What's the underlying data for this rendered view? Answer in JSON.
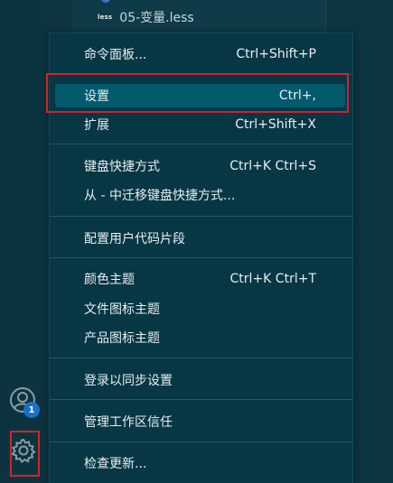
{
  "explorer": {
    "file_name": "05-变量.less",
    "file_badge": "less"
  },
  "activity_bar": {
    "accounts_badge": "1"
  },
  "menu": {
    "items": [
      {
        "label": "命令面板...",
        "shortcut": "Ctrl+Shift+P"
      },
      {
        "label": "设置",
        "shortcut": "Ctrl+,"
      },
      {
        "label": "扩展",
        "shortcut": "Ctrl+Shift+X"
      },
      {
        "label": "键盘快捷方式",
        "shortcut": "Ctrl+K Ctrl+S"
      },
      {
        "label": "从 - 中迁移键盘快捷方式...",
        "shortcut": ""
      },
      {
        "label": "配置用户代码片段",
        "shortcut": ""
      },
      {
        "label": "颜色主题",
        "shortcut": "Ctrl+K Ctrl+T"
      },
      {
        "label": "文件图标主题",
        "shortcut": ""
      },
      {
        "label": "产品图标主题",
        "shortcut": ""
      },
      {
        "label": "登录以同步设置",
        "shortcut": ""
      },
      {
        "label": "管理工作区信任",
        "shortcut": ""
      },
      {
        "label": "检查更新...",
        "shortcut": ""
      }
    ]
  }
}
